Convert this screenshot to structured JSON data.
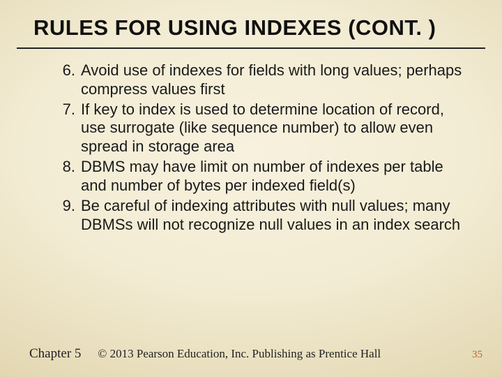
{
  "title": "RULES FOR USING INDEXES (CONT. )",
  "list_start": 6,
  "rules": [
    "Avoid use of indexes for fields with long values; perhaps compress values first",
    "If key to index is used to determine location of record, use surrogate (like sequence number) to allow even spread in storage area",
    "DBMS may have limit on number of indexes per table and number of bytes per indexed field(s)",
    "Be careful of indexing attributes with null values; many DBMSs will not recognize null values in an index search"
  ],
  "footer": {
    "chapter": "Chapter 5",
    "copyright": "© 2013 Pearson Education, Inc.  Publishing as Prentice Hall",
    "page": "35"
  }
}
